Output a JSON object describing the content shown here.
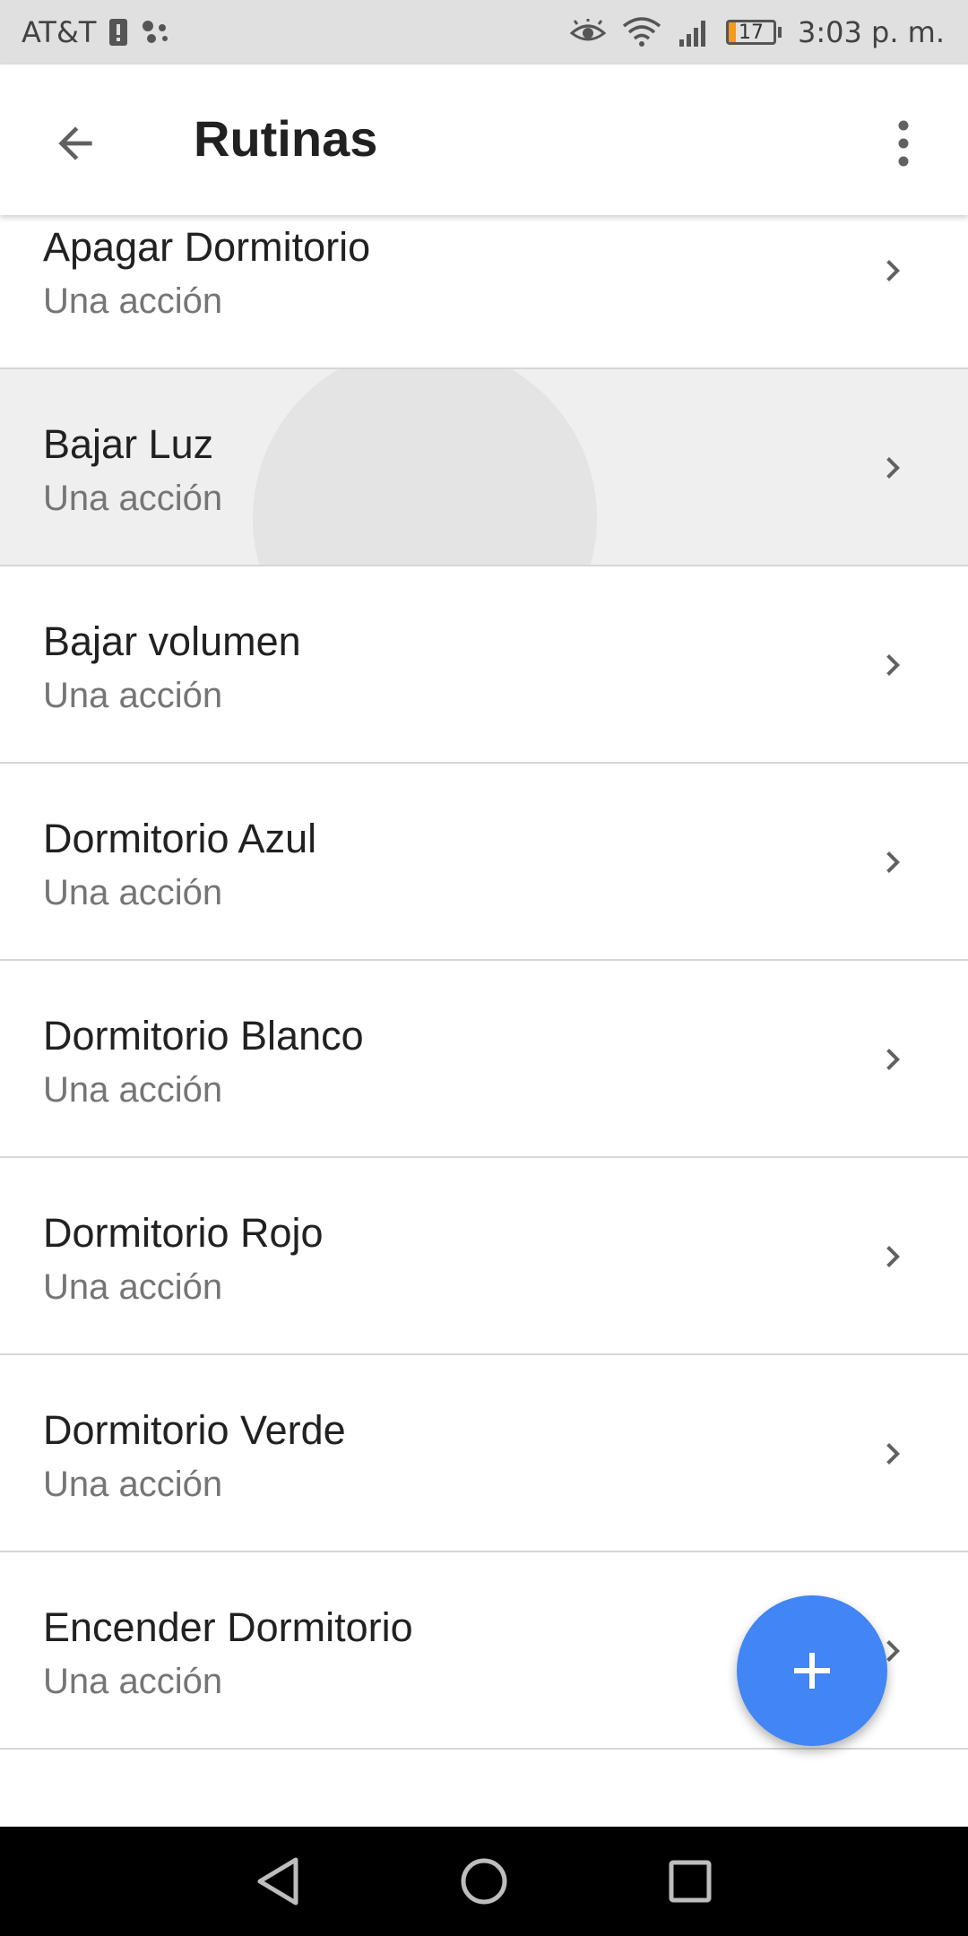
{
  "status_bar": {
    "carrier": "AT&T",
    "battery_level": "17",
    "battery_fraction": 0.17,
    "time": "3:03 p. m."
  },
  "app_bar": {
    "title": "Rutinas",
    "back_icon": "arrow-back-icon",
    "menu_icon": "more-vert-icon"
  },
  "routines": [
    {
      "title": "Apagar Dormitorio",
      "subtitle": "Una acción"
    },
    {
      "title": "Bajar Luz",
      "subtitle": "Una acción"
    },
    {
      "title": "Bajar volumen",
      "subtitle": "Una acción"
    },
    {
      "title": "Dormitorio Azul",
      "subtitle": "Una acción"
    },
    {
      "title": "Dormitorio Blanco",
      "subtitle": "Una acción"
    },
    {
      "title": "Dormitorio Rojo",
      "subtitle": "Una acción"
    },
    {
      "title": "Dormitorio Verde",
      "subtitle": "Una acción"
    },
    {
      "title": "Encender Dormitorio",
      "subtitle": "Una acción"
    }
  ],
  "fab": {
    "icon": "plus-icon",
    "color": "#4285f4"
  },
  "nav_bar": {
    "back_icon": "nav-back-icon",
    "home_icon": "nav-home-icon",
    "recents_icon": "nav-recents-icon"
  }
}
